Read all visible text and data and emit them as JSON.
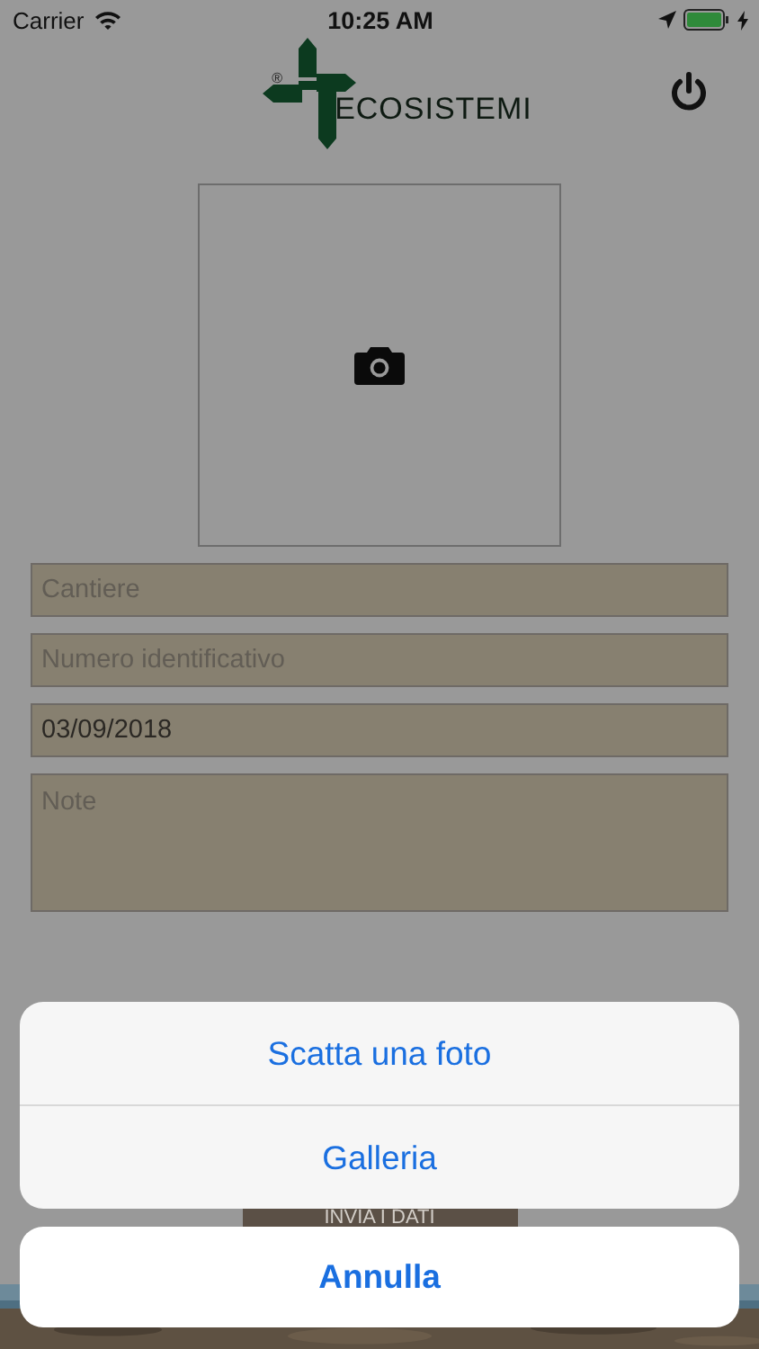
{
  "status_bar": {
    "carrier": "Carrier",
    "time": "10:25 AM"
  },
  "header": {
    "logo_text": "ECOSISTEMI",
    "registered_mark": "®"
  },
  "photo": {
    "kind": "camera-placeholder"
  },
  "fields": [
    {
      "placeholder": "Cantiere",
      "kind": "text"
    },
    {
      "placeholder": "Numero identificativo",
      "kind": "text"
    },
    {
      "value": "03/09/2018",
      "kind": "text"
    },
    {
      "placeholder": "Note",
      "kind": "multiline"
    }
  ],
  "submit_button": "INVIA I DATI",
  "action_sheet": {
    "actions": [
      "Scatta una foto",
      "Galleria"
    ],
    "cancel": "Annulla"
  }
}
